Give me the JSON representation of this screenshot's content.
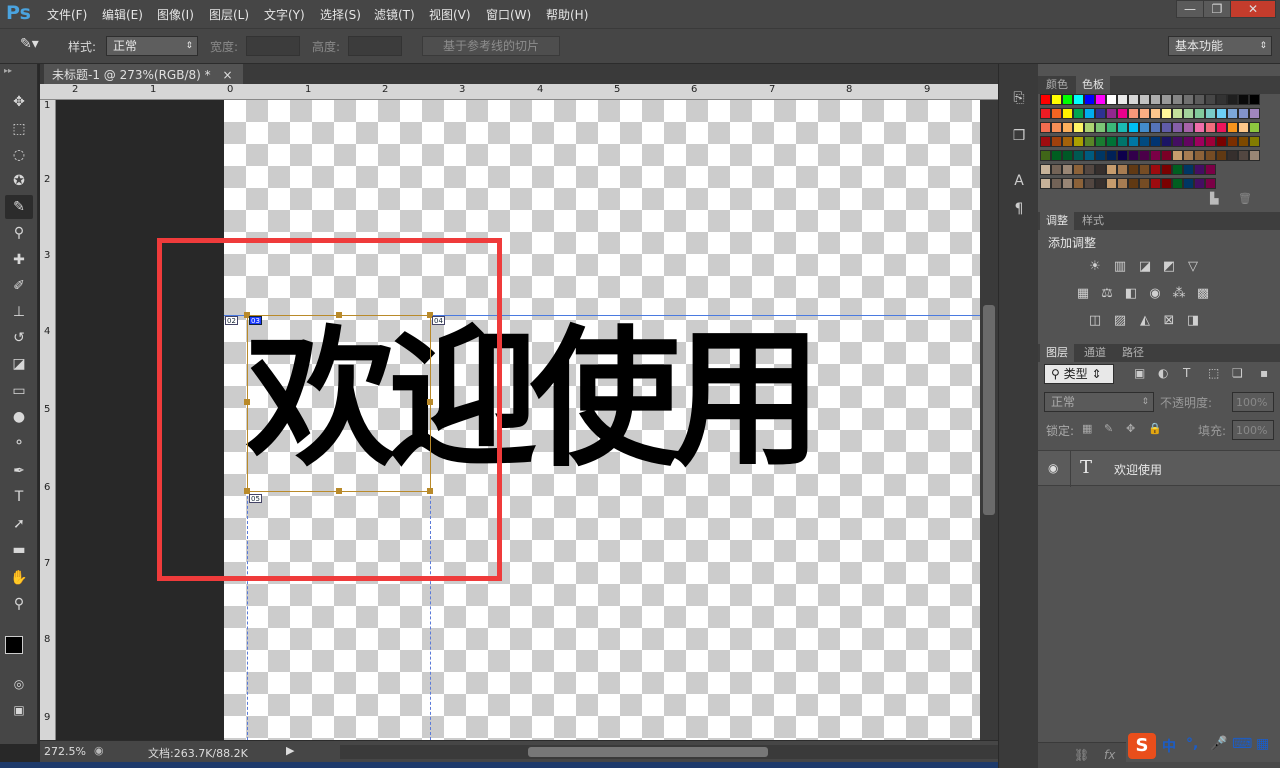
{
  "app": {
    "logo": "Ps"
  },
  "menu": [
    "文件(F)",
    "编辑(E)",
    "图像(I)",
    "图层(L)",
    "文字(Y)",
    "选择(S)",
    "滤镜(T)",
    "视图(V)",
    "窗口(W)",
    "帮助(H)"
  ],
  "window_controls": {
    "minimize": "—",
    "restore": "❐",
    "close": "✕"
  },
  "options": {
    "style_label": "样式:",
    "style_value": "正常",
    "width_label": "宽度:",
    "height_label": "高度:",
    "slice_button": "基于参考线的切片",
    "workspace": "基本功能"
  },
  "document": {
    "tab_title": "未标题-1 @ 273%(RGB/8) *",
    "tab_close": "×",
    "canvas_text": "欢迎使用",
    "ruler_h": [
      "2",
      "1",
      "0",
      "1",
      "2",
      "3",
      "4",
      "5",
      "6",
      "7",
      "8",
      "9"
    ],
    "ruler_v": [
      "1",
      "2",
      "3",
      "4",
      "5",
      "6",
      "7",
      "8",
      "9"
    ],
    "slice_labels": [
      "02",
      "03",
      "04",
      "05"
    ]
  },
  "status": {
    "zoom": "272.5%",
    "doc_size": "文档:263.7K/88.2K"
  },
  "right_panel": {
    "color_tabs": [
      "颜色",
      "色板"
    ],
    "adjust_tabs": [
      "调整",
      "样式"
    ],
    "adjust_title": "添加调整",
    "layers_tabs": [
      "图层",
      "通道",
      "路径"
    ],
    "layer_filter": "类型",
    "blend_mode": "正常",
    "opacity_label": "不透明度:",
    "opacity_value": "100%",
    "lock_label": "锁定:",
    "fill_label": "填充:",
    "fill_value": "100%",
    "layer_name": "欢迎使用",
    "layer_type_glyph": "T"
  },
  "ime": {
    "logo": "S",
    "lang": "中",
    "punct": "°,"
  },
  "highlight_color": "#ef3b3b"
}
